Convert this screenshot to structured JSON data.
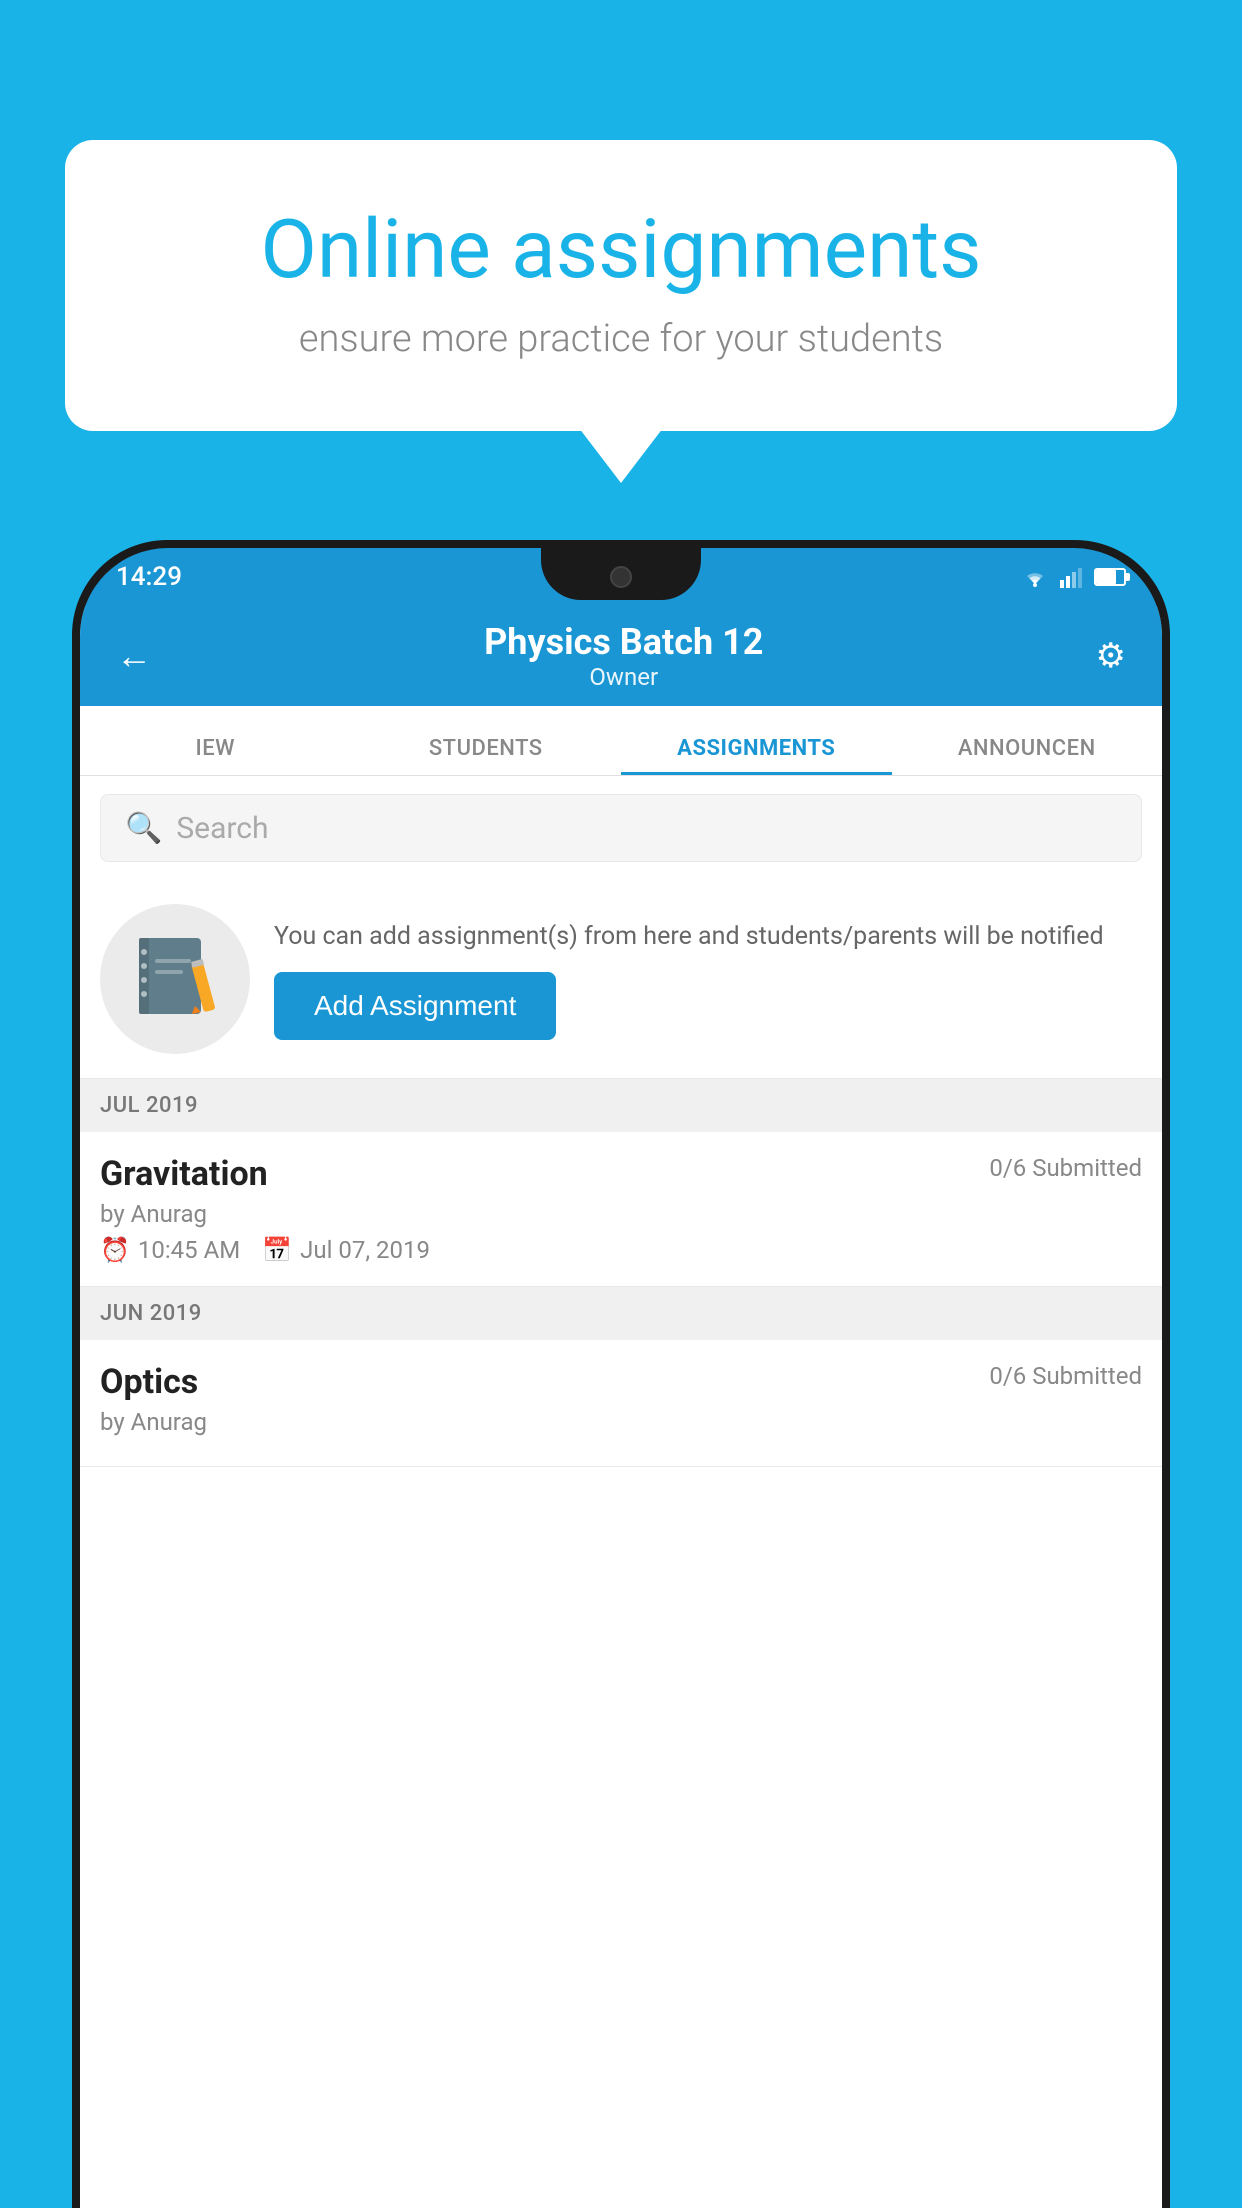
{
  "background_color": "#1ab3e8",
  "speech_bubble": {
    "title": "Online assignments",
    "subtitle": "ensure more practice for your students"
  },
  "status_bar": {
    "time": "14:29"
  },
  "app_header": {
    "title": "Physics Batch 12",
    "subtitle": "Owner"
  },
  "tabs": [
    {
      "label": "IEW",
      "active": false
    },
    {
      "label": "STUDENTS",
      "active": false
    },
    {
      "label": "ASSIGNMENTS",
      "active": true
    },
    {
      "label": "ANNOUNCEM...",
      "active": false
    }
  ],
  "search": {
    "placeholder": "Search"
  },
  "promo": {
    "text": "You can add assignment(s) from here and students/parents will be notified",
    "button_label": "Add Assignment"
  },
  "sections": [
    {
      "label": "JUL 2019",
      "assignments": [
        {
          "name": "Gravitation",
          "submitted": "0/6 Submitted",
          "by": "by Anurag",
          "time": "10:45 AM",
          "date": "Jul 07, 2019"
        }
      ]
    },
    {
      "label": "JUN 2019",
      "assignments": [
        {
          "name": "Optics",
          "submitted": "0/6 Submitted",
          "by": "by Anurag",
          "time": "",
          "date": ""
        }
      ]
    }
  ]
}
